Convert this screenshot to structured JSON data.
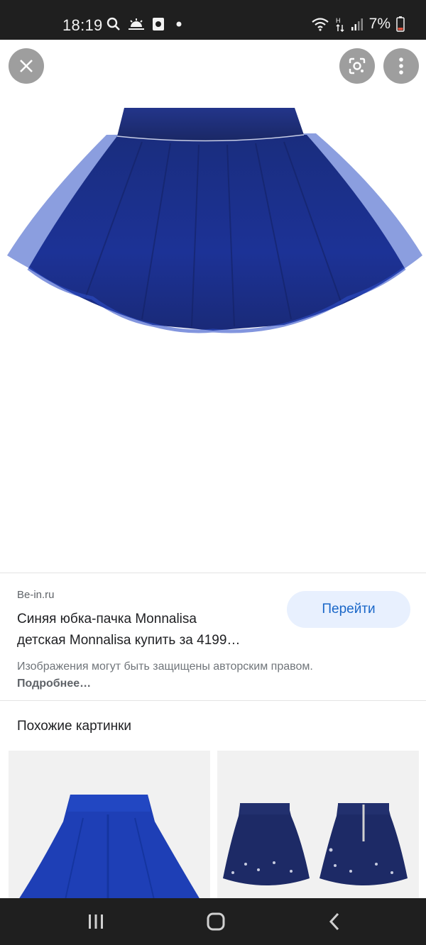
{
  "status_bar": {
    "time": "18:19",
    "battery": "7%",
    "icons": [
      "search-icon",
      "weather-icon",
      "app-notification-icon",
      "dot-icon",
      "wifi-icon",
      "data-transfer-icon",
      "signal-icon",
      "battery-icon"
    ]
  },
  "overlay": {
    "close_icon": "close-icon",
    "lens_icon": "lens-icon",
    "more_icon": "more-vert-icon"
  },
  "result": {
    "source": "Be-in.ru",
    "title_line1": "Синяя юбка-пачка Monnalisa",
    "title_line2": "детская Monnalisa купить за 4199…",
    "visit_label": "Перейти",
    "copyright_text": "Изображения могут быть защищены авторским правом.",
    "more_link": "Подробнее…"
  },
  "similar": {
    "heading": "Похожие картинки"
  },
  "nav": {
    "icons": [
      "recent-apps-icon",
      "home-icon",
      "back-icon"
    ]
  },
  "colors": {
    "status_bar_bg": "#1f1f1f",
    "skirt_navy": "#1b2f7a",
    "visit_button_bg": "#e8f0fe",
    "visit_button_text": "#1a67c8"
  }
}
